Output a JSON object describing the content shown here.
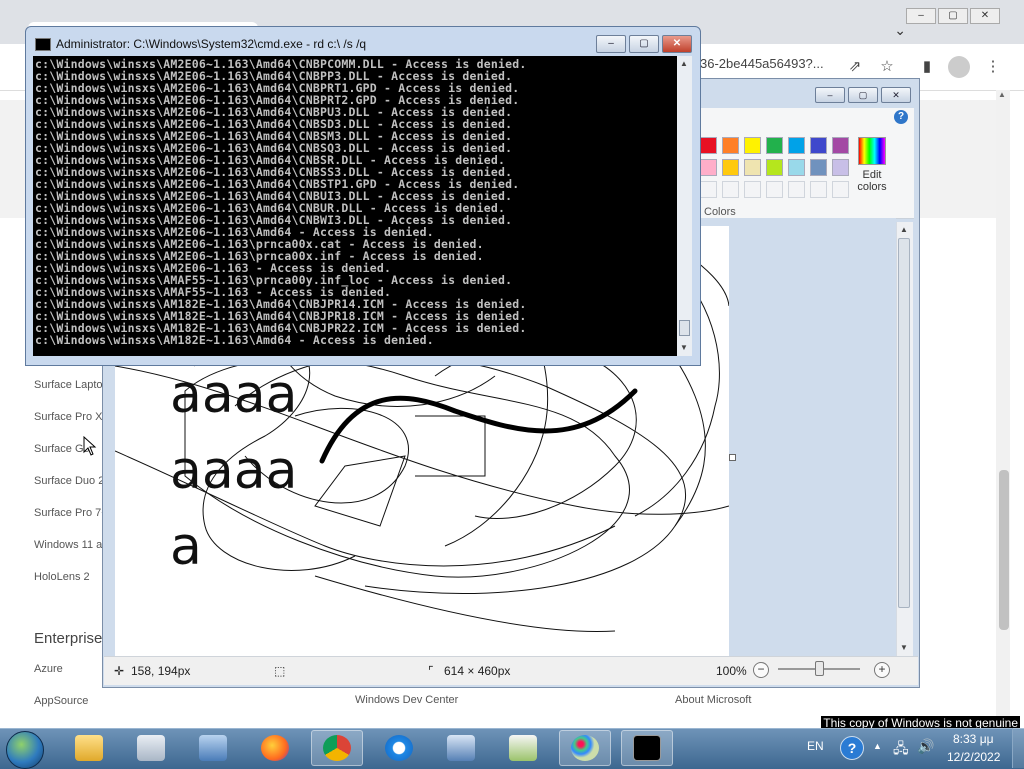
{
  "browser": {
    "url_fragment": "36-2be445a56493?...",
    "sidebar_links": [
      "Surface Laptop",
      "Surface Pro X",
      "Surface Go",
      "Surface Duo 2",
      "Surface Pro 7+",
      "Windows 11 a",
      "HoloLens 2"
    ],
    "enterprise_heading": "Enterprise",
    "enterprise_links": [
      "Azure",
      "AppSource"
    ],
    "footer": {
      "dev_center": "Windows Dev Center",
      "about": "About Microsoft"
    },
    "genuine_notice": "This copy of Windows is not genuine"
  },
  "paint": {
    "colors_label": "Colors",
    "edit_colors_label": "Edit colors",
    "palette_row1": [
      "#e81123",
      "#ff7f27",
      "#fff200",
      "#22b14c",
      "#00a2e8",
      "#3f48cc",
      "#a349a4"
    ],
    "palette_row2": [
      "#ffaec9",
      "#ffc90e",
      "#efe4b0",
      "#b5e61d",
      "#99d9ea",
      "#7092be",
      "#c8bfe7"
    ],
    "canvas_text": [
      "aaaa",
      "aaaa",
      "a"
    ],
    "status": {
      "cursor_pos": "158, 194px",
      "image_size": "614 × 460px",
      "zoom": "100%"
    }
  },
  "cmd": {
    "title": "Administrator: C:\\Windows\\System32\\cmd.exe - rd  c:\\ /s /q",
    "lines": [
      "c:\\Windows\\winsxs\\AM2E06~1.163\\Amd64\\CNBPCOMM.DLL - Access is denied.",
      "c:\\Windows\\winsxs\\AM2E06~1.163\\Amd64\\CNBPP3.DLL - Access is denied.",
      "c:\\Windows\\winsxs\\AM2E06~1.163\\Amd64\\CNBPRT1.GPD - Access is denied.",
      "c:\\Windows\\winsxs\\AM2E06~1.163\\Amd64\\CNBPRT2.GPD - Access is denied.",
      "c:\\Windows\\winsxs\\AM2E06~1.163\\Amd64\\CNBPU3.DLL - Access is denied.",
      "c:\\Windows\\winsxs\\AM2E06~1.163\\Amd64\\CNBSD3.DLL - Access is denied.",
      "c:\\Windows\\winsxs\\AM2E06~1.163\\Amd64\\CNBSM3.DLL - Access is denied.",
      "c:\\Windows\\winsxs\\AM2E06~1.163\\Amd64\\CNBSQ3.DLL - Access is denied.",
      "c:\\Windows\\winsxs\\AM2E06~1.163\\Amd64\\CNBSR.DLL - Access is denied.",
      "c:\\Windows\\winsxs\\AM2E06~1.163\\Amd64\\CNBSS3.DLL - Access is denied.",
      "c:\\Windows\\winsxs\\AM2E06~1.163\\Amd64\\CNBSTP1.GPD - Access is denied.",
      "c:\\Windows\\winsxs\\AM2E06~1.163\\Amd64\\CNBUI3.DLL - Access is denied.",
      "c:\\Windows\\winsxs\\AM2E06~1.163\\Amd64\\CNBUR.DLL - Access is denied.",
      "c:\\Windows\\winsxs\\AM2E06~1.163\\Amd64\\CNBWI3.DLL - Access is denied.",
      "c:\\Windows\\winsxs\\AM2E06~1.163\\Amd64 - Access is denied.",
      "c:\\Windows\\winsxs\\AM2E06~1.163\\prnca00x.cat - Access is denied.",
      "c:\\Windows\\winsxs\\AM2E06~1.163\\prnca00x.inf - Access is denied.",
      "c:\\Windows\\winsxs\\AM2E06~1.163 - Access is denied.",
      "c:\\Windows\\winsxs\\AMAF55~1.163\\prnca00y.inf_loc - Access is denied.",
      "c:\\Windows\\winsxs\\AMAF55~1.163 - Access is denied.",
      "c:\\Windows\\winsxs\\AM182E~1.163\\Amd64\\CNBJPR14.ICM - Access is denied.",
      "c:\\Windows\\winsxs\\AM182E~1.163\\Amd64\\CNBJPR18.ICM - Access is denied.",
      "c:\\Windows\\winsxs\\AM182E~1.163\\Amd64\\CNBJPR22.ICM - Access is denied.",
      "c:\\Windows\\winsxs\\AM182E~1.163\\Amd64 - Access is denied."
    ]
  },
  "taskbar": {
    "language": "EN",
    "time": "8:33 μμ",
    "date": "12/2/2022",
    "apps": [
      "windows-explorer-icon",
      "calculator-icon",
      "remote-desktop-icon",
      "firefox-icon",
      "chrome-icon",
      "internet-explorer-icon",
      "network-scanner-icon",
      "chart-app-icon",
      "paint-icon",
      "cmd-icon"
    ]
  }
}
